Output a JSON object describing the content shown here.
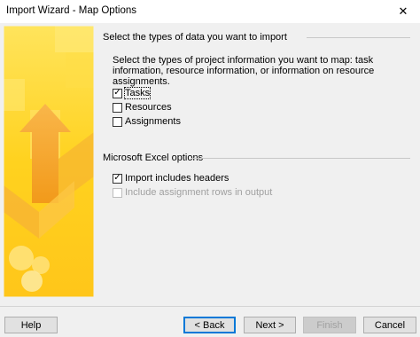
{
  "window": {
    "title": "Import Wizard - Map Options",
    "close_glyph": "✕"
  },
  "data_types": {
    "header": "Select the types of data you want to import",
    "description": "Select the types of project information you want to map: task information, resource information, or information on resource assignments.",
    "options": [
      {
        "label": "Tasks",
        "checked": true,
        "enabled": true
      },
      {
        "label": "Resources",
        "checked": false,
        "enabled": true
      },
      {
        "label": "Assignments",
        "checked": false,
        "enabled": true
      }
    ]
  },
  "excel_options": {
    "header": "Microsoft Excel options",
    "options": [
      {
        "label": "Import includes headers",
        "checked": true,
        "enabled": true
      },
      {
        "label": "Include assignment rows in output",
        "checked": false,
        "enabled": false
      }
    ]
  },
  "buttons": {
    "help": "Help",
    "back": "< Back",
    "next": "Next >",
    "finish": "Finish",
    "cancel": "Cancel"
  },
  "icons": {
    "close": "close-icon",
    "checkmark": "checkmark-icon"
  },
  "colors": {
    "art_yellow": "#ffd21f",
    "art_orange": "#f7a823",
    "art_light": "#ffe97a",
    "default_button_border": "#0078d7"
  }
}
